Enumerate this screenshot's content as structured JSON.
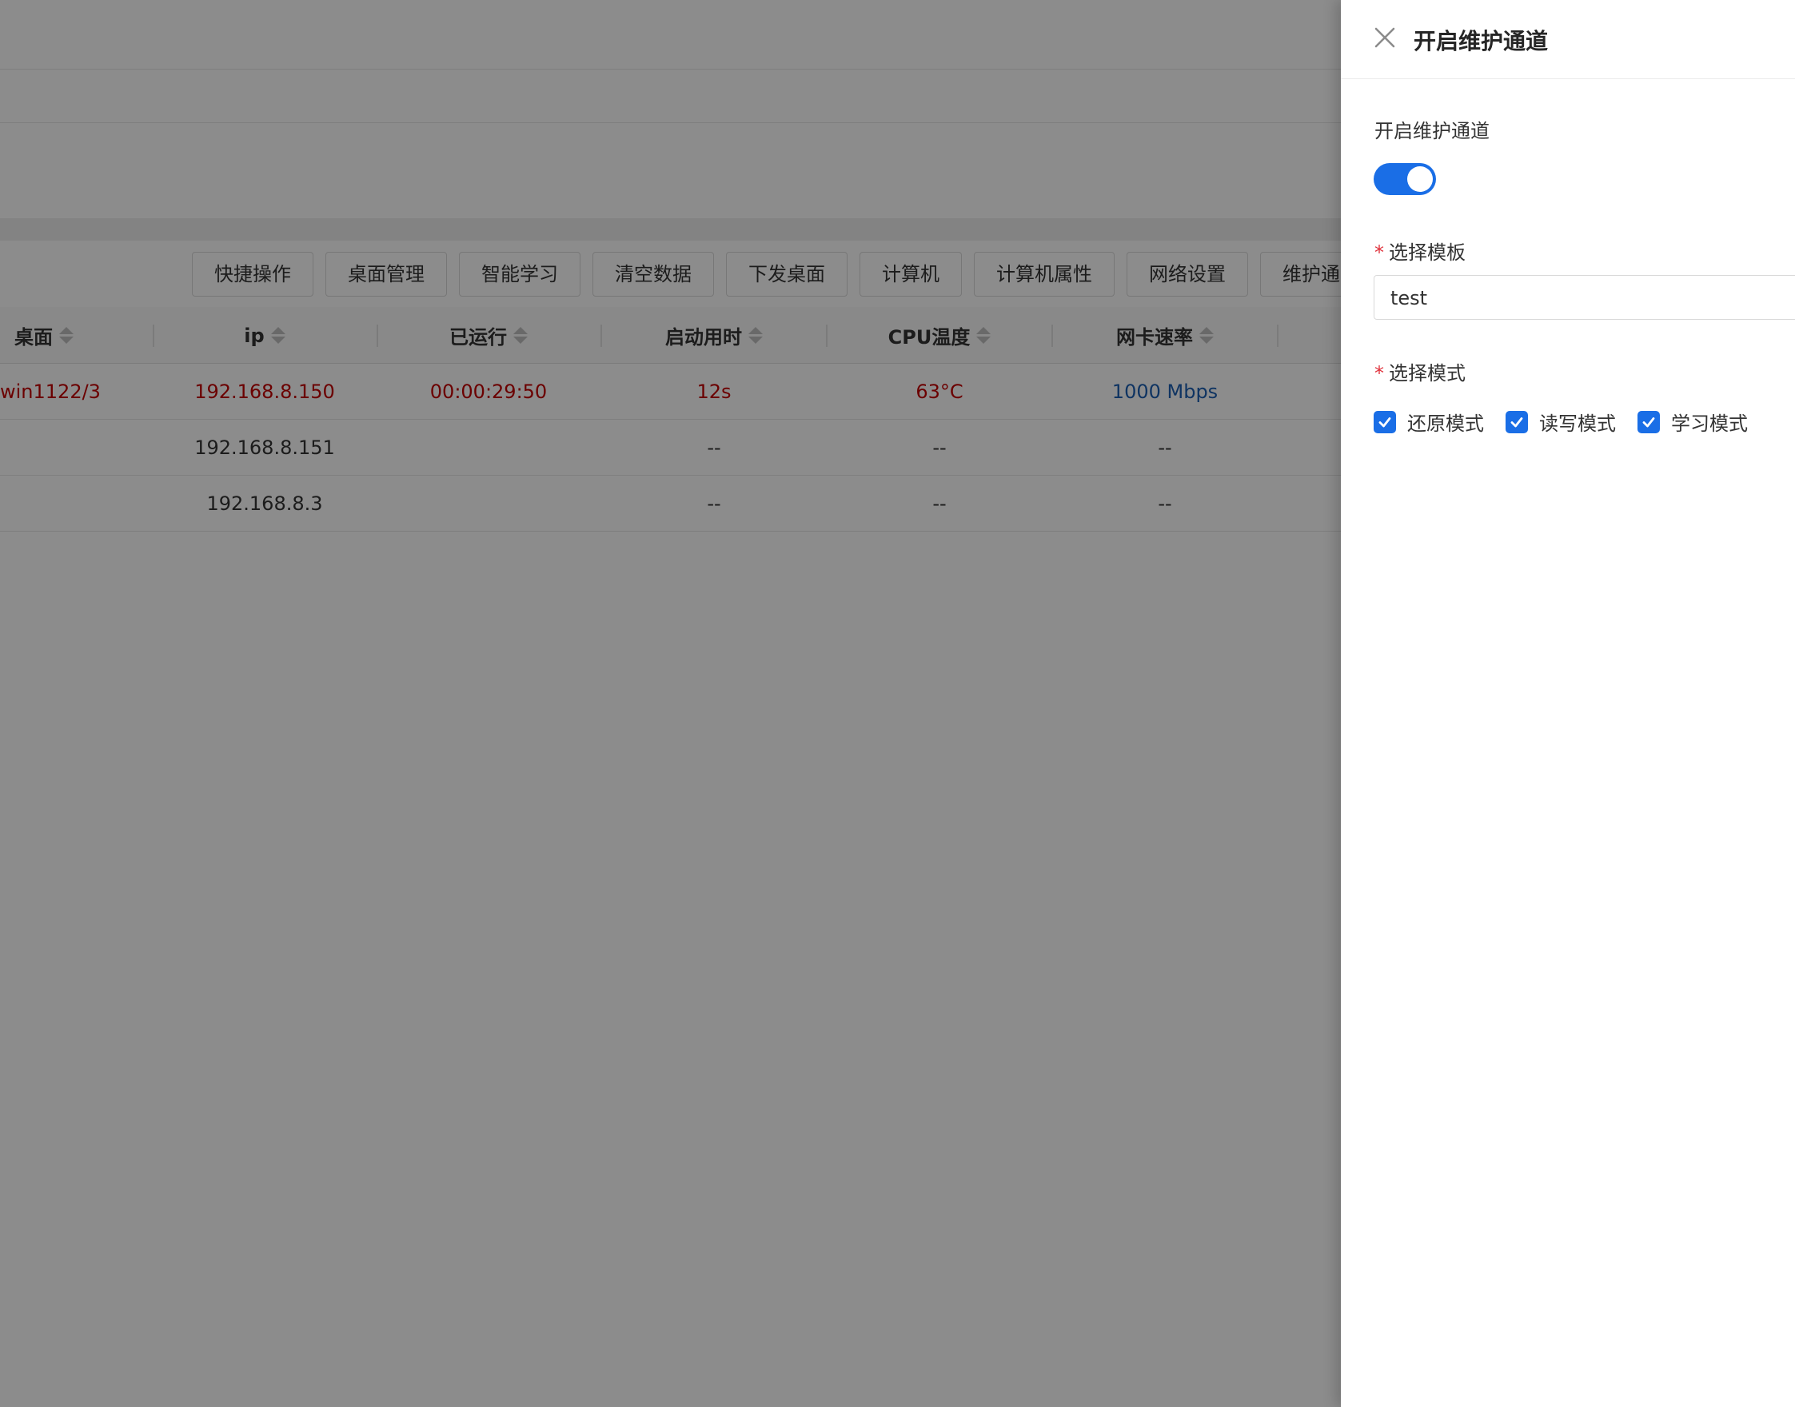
{
  "toolbar": {
    "buttons": [
      "快捷操作",
      "桌面管理",
      "智能学习",
      "清空数据",
      "下发桌面",
      "计算机",
      "计算机属性",
      "网络设置",
      "维护通道"
    ]
  },
  "table": {
    "columns": [
      "桌面",
      "ip",
      "已运行",
      "启动用时",
      "CPU温度",
      "网卡速率"
    ],
    "rows": [
      {
        "desktop": "win1122/3",
        "ip": "192.168.8.150",
        "running": "00:00:29:50",
        "boot_time": "12s",
        "cpu_temp": "63°C",
        "nic_speed": "1000 Mbps"
      },
      {
        "desktop": "",
        "ip": "192.168.8.151",
        "running": "",
        "boot_time": "--",
        "cpu_temp": "--",
        "nic_speed": "--"
      },
      {
        "desktop": "",
        "ip": "192.168.8.3",
        "running": "",
        "boot_time": "--",
        "cpu_temp": "--",
        "nic_speed": "--"
      }
    ]
  },
  "drawer": {
    "title": "开启维护通道",
    "switch_label": "开启维护通道",
    "switch_on": true,
    "required_mark": "*",
    "template_label": "选择模板",
    "template_value": "test",
    "mode_label": "选择模式",
    "modes": [
      {
        "label": "还原模式",
        "checked": true
      },
      {
        "label": "读写模式",
        "checked": true
      },
      {
        "label": "学习模式",
        "checked": true
      }
    ]
  },
  "colors": {
    "accent": "#1a6ee6",
    "error_row": "#c40000",
    "link": "#1d5fb3",
    "required": "#e0323c"
  },
  "icons": {
    "close": "close-icon",
    "sort": "sort-icon",
    "check": "check-icon"
  }
}
